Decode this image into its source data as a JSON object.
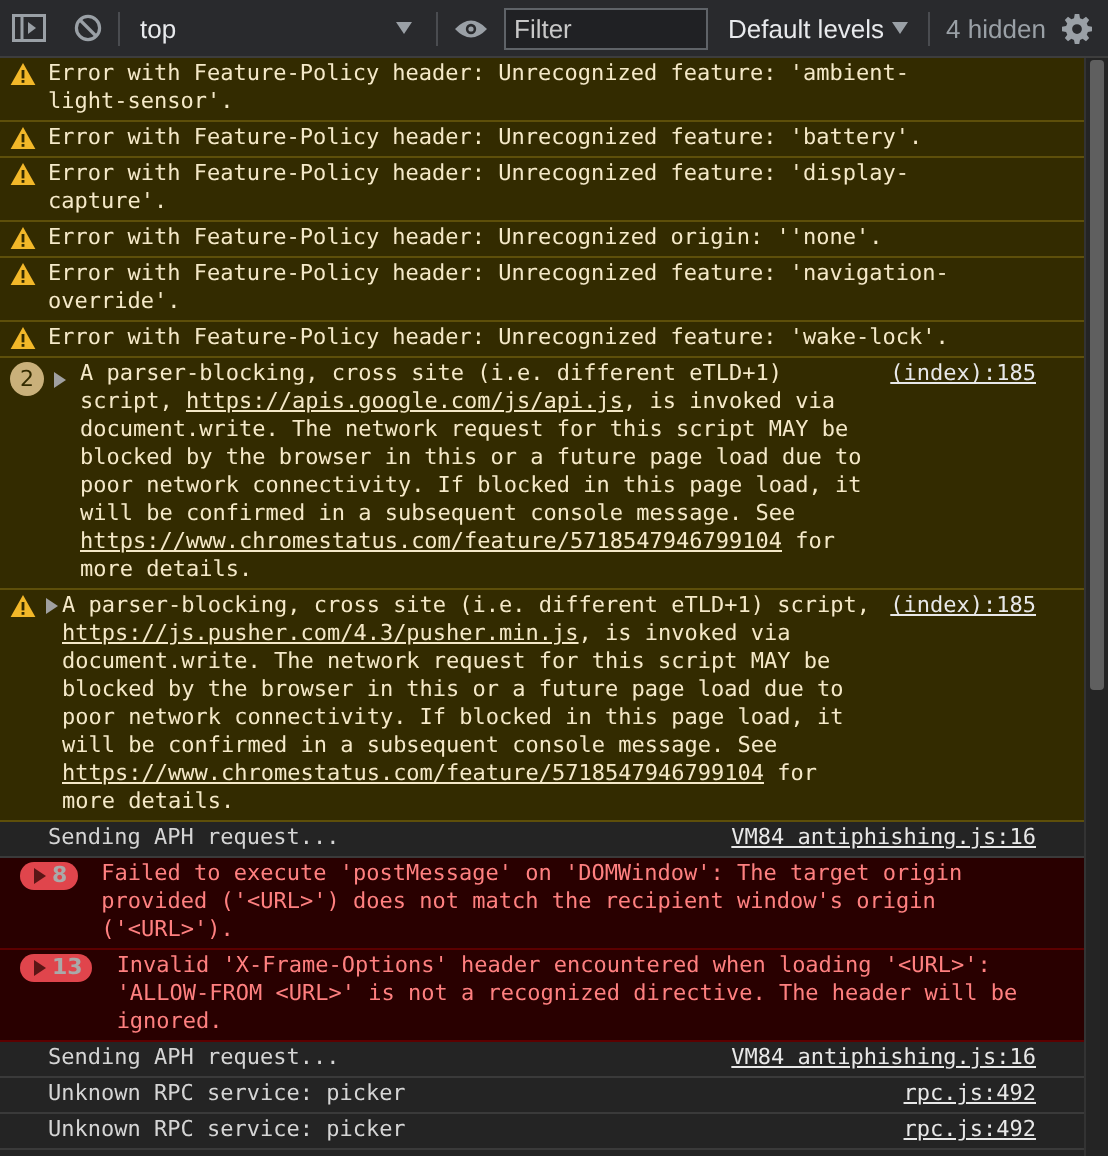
{
  "toolbar": {
    "context": "top",
    "filter": {
      "placeholder": "Filter"
    },
    "levels": "Default levels",
    "hidden": "4 hidden"
  },
  "messages": [
    {
      "kind": "warning",
      "expandable": false,
      "text": "Error with Feature-Policy header: Unrecognized feature: 'ambient-light-sensor'."
    },
    {
      "kind": "warning",
      "expandable": false,
      "text": "Error with Feature-Policy header: Unrecognized feature: 'battery'."
    },
    {
      "kind": "warning",
      "expandable": false,
      "text": "Error with Feature-Policy header: Unrecognized feature: 'display-capture'."
    },
    {
      "kind": "warning",
      "expandable": false,
      "text": "Error with Feature-Policy header: Unrecognized origin: ''none'."
    },
    {
      "kind": "warning",
      "expandable": false,
      "text": "Error with Feature-Policy header: Unrecognized feature: 'navigation-override'."
    },
    {
      "kind": "warning",
      "expandable": false,
      "text": "Error with Feature-Policy header: Unrecognized feature: 'wake-lock'."
    },
    {
      "kind": "warning",
      "count": "2",
      "expandable": true,
      "source": "(index):185",
      "parts": [
        {
          "text": "A parser-blocking, cross site (i.e. different eTLD+1) script, ",
          "kind": "text"
        },
        {
          "text": "https://apis.google.com/js/api.js",
          "kind": "link"
        },
        {
          "text": ", is invoked via document.write. The network request for this script MAY be blocked by the browser in this or a future page load due to poor network connectivity. If blocked in this page load, it will be confirmed in a subsequent console message. See ",
          "kind": "text"
        },
        {
          "text": "https://www.chromestatus.com/feature/5718547946799104",
          "kind": "link"
        },
        {
          "text": " for more details.",
          "kind": "text"
        }
      ]
    },
    {
      "kind": "warning",
      "expandable": true,
      "source": "(index):185",
      "parts": [
        {
          "text": "A parser-blocking, cross site (i.e. different eTLD+1) script, ",
          "kind": "text"
        },
        {
          "text": "https://js.pusher.com/4.3/pusher.min.js",
          "kind": "link"
        },
        {
          "text": ", is invoked via document.write. The network request for this script MAY be blocked by the browser in this or a future page load due to poor network connectivity. If blocked in this page load, it will be confirmed in a subsequent console message. See ",
          "kind": "text"
        },
        {
          "text": "https://www.chromestatus.com/feature/5718547946799104",
          "kind": "link"
        },
        {
          "text": " for more details.",
          "kind": "text"
        }
      ]
    },
    {
      "kind": "log",
      "expandable": false,
      "source": "VM84 antiphishing.js:16",
      "text": "Sending APH request..."
    },
    {
      "kind": "error",
      "count": "8",
      "expandable": false,
      "text": "Failed to execute 'postMessage' on 'DOMWindow': The target origin provided ('<URL>') does not match the recipient window's origin ('<URL>')."
    },
    {
      "kind": "error",
      "count": "13",
      "expandable": false,
      "text": "Invalid 'X-Frame-Options' header encountered when loading '<URL>': 'ALLOW-FROM <URL>' is not a recognized directive. The header will be ignored."
    },
    {
      "kind": "log",
      "expandable": false,
      "source": "VM84 antiphishing.js:16",
      "text": "Sending APH request..."
    },
    {
      "kind": "log",
      "expandable": false,
      "source": "rpc.js:492",
      "text": "Unknown RPC service: picker"
    },
    {
      "kind": "log",
      "expandable": false,
      "source": "rpc.js:492",
      "text": "Unknown RPC service: picker"
    }
  ]
}
